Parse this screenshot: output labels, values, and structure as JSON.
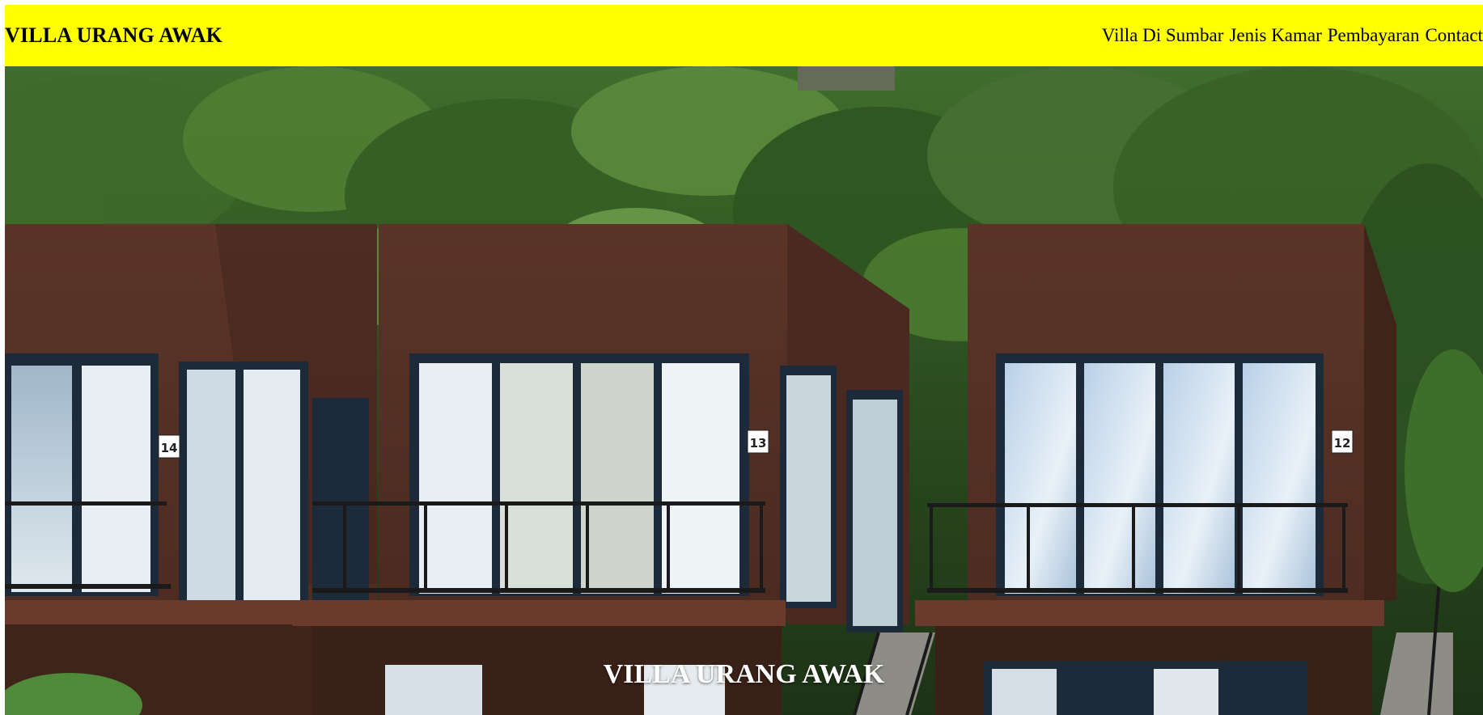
{
  "header": {
    "brand": "VILLA URANG AWAK",
    "nav": [
      {
        "label": "Villa Di Sumbar"
      },
      {
        "label": "Jenis Kamar"
      },
      {
        "label": "Pembayaran"
      },
      {
        "label": "Contact"
      }
    ]
  },
  "hero": {
    "title": "VILLA URANG AWAK",
    "image_description_icon": "villa-photo-icon",
    "villas": [
      {
        "number": "14"
      },
      {
        "number": "13"
      },
      {
        "number": "12"
      }
    ]
  },
  "colors": {
    "header_bg": "#ffff00",
    "title_text": "#ffffff",
    "villa_wall": "#5a3326",
    "frame": "#1d2a3a",
    "foliage": "#2f5a24"
  }
}
